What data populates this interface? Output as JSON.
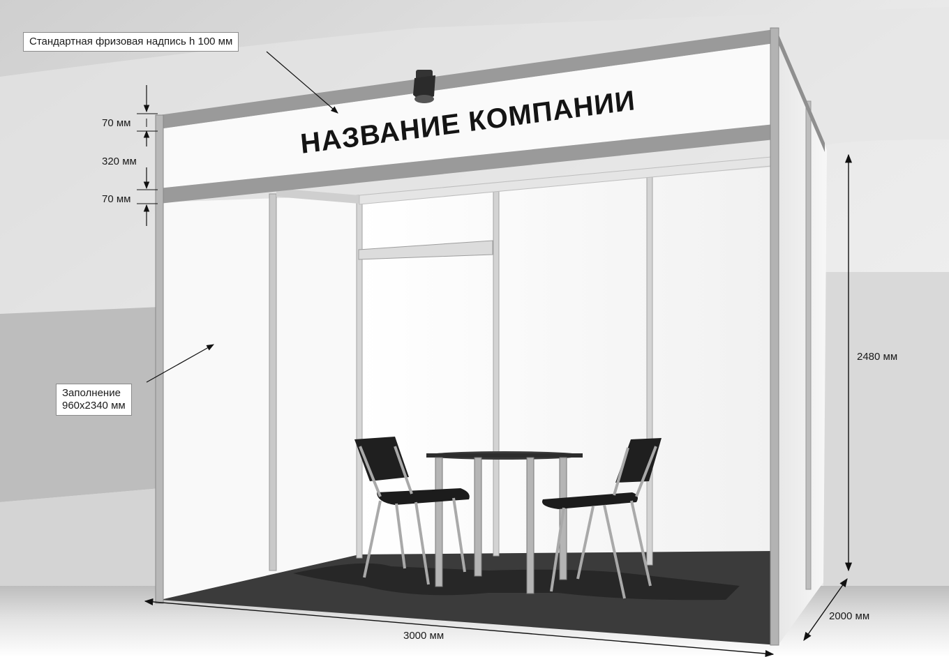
{
  "callouts": {
    "fascia_note": "Стандартная фризовая надпись  h 100 мм",
    "infill_line1": "Заполнение",
    "infill_line2": "960х2340 мм"
  },
  "fascia_text": "НАЗВАНИЕ КОМПАНИИ",
  "dimensions": {
    "frieze_top": "70 мм",
    "frieze_panel": "320 мм",
    "frieze_bottom": "70 мм",
    "height": "2480 мм",
    "depth": "2000 мм",
    "width": "3000 мм"
  }
}
